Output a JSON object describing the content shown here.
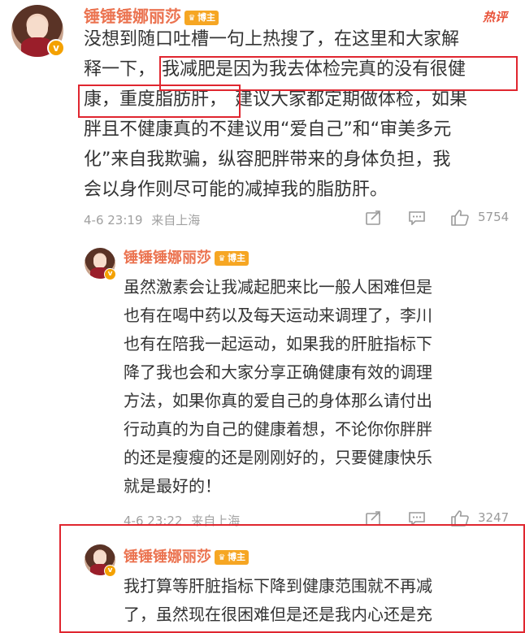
{
  "hot_label": "热评",
  "badge_label": "博主",
  "main_comment": {
    "author": "锤锤锤娜丽莎",
    "lines": [
      "没想到随口吐槽一句上热搜了，在这里和大家解",
      "释一下，",
      "我减肥是因为我去体检完真的没有很健",
      "康，重度脂肪肝，",
      "建议大家都定期做体检，如果",
      "胖且不健康真的不建议用“爱自己”和“审美多元",
      "化”来自我欺骗，纵容肥胖带来的身体负担，我",
      "会以身作则尽可能的减掉我的脂肪肝。"
    ],
    "time": "4-6 23:19",
    "location": "来自上海",
    "likes": "5754"
  },
  "reply1": {
    "author": "锤锤锤娜丽莎",
    "lines": [
      "虽然激素会让我减起肥来比一般人困难但是",
      "也有在喝中药以及每天运动来调理了，李川",
      "也有在陪我一起运动，如果我的肝脏指标下",
      "降了我也会和大家分享正确健康有效的调理",
      "方法，如果你真的爱自己的身体那么请付出",
      "行动真的为自己的健康着想，不论你你胖胖",
      "的还是瘦瘦的还是刚刚好的，只要健康快乐",
      "就是最好的！"
    ],
    "time": "4-6 23:22",
    "location": "来自上海",
    "likes": "3247"
  },
  "reply2": {
    "author": "锤锤锤娜丽莎",
    "lines": [
      "我打算等肝脏指标下降到健康范围就不再减",
      "了，虽然现在很困难但是还是我内心还是充"
    ]
  },
  "colors": {
    "name": "#eb7350",
    "highlight_box": "#e0262f",
    "badge": "#f6a623",
    "text": "#333333",
    "meta": "#a0a0a0"
  },
  "icons": [
    "share-icon",
    "comment-icon",
    "like-icon",
    "verified-icon"
  ]
}
